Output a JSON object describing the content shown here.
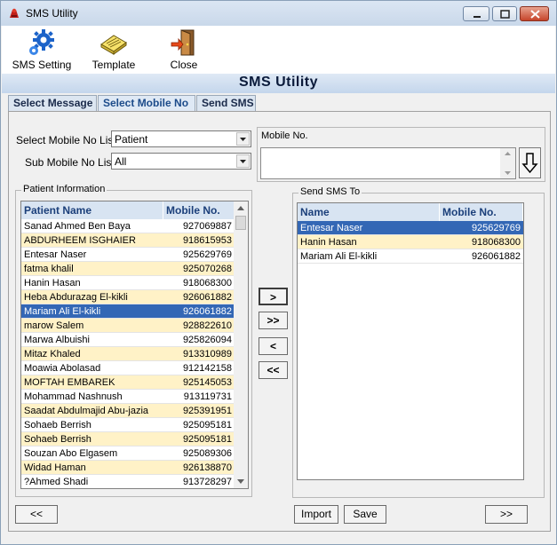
{
  "window": {
    "title": "SMS Utility"
  },
  "toolbar": {
    "sms_setting": "SMS Setting",
    "template": "Template",
    "close": "Close"
  },
  "banner": "SMS Utility",
  "tabs": [
    {
      "label": "Select Message"
    },
    {
      "label": "Select Mobile No"
    },
    {
      "label": "Send SMS"
    }
  ],
  "filters": {
    "mobile_list_label": "Select Mobile No List",
    "mobile_list_value": "Patient",
    "sub_list_label": "Sub Mobile No List",
    "sub_list_value": "All"
  },
  "mobile_no": {
    "label": "Mobile No.",
    "value": ""
  },
  "patients": {
    "title": "Patient Information",
    "col_name": "Patient Name",
    "col_mobile": "Mobile No.",
    "rows": [
      {
        "name": "Sanad Ahmed  Ben Baya",
        "mobile": "927069887"
      },
      {
        "name": "ABDURHEEM ISGHAIER",
        "mobile": "918615953"
      },
      {
        "name": "Entesar Naser",
        "mobile": "925629769"
      },
      {
        "name": "fatma khalil",
        "mobile": "925070268"
      },
      {
        "name": "Hanin Hasan",
        "mobile": "918068300"
      },
      {
        "name": "Heba Abdurazag  El-kikli",
        "mobile": "926061882"
      },
      {
        "name": "Mariam Ali   El-kikli",
        "mobile": "926061882"
      },
      {
        "name": "marow Salem",
        "mobile": "928822610"
      },
      {
        "name": "Marwa Albuishi",
        "mobile": "925826094"
      },
      {
        "name": "Mitaz  Khaled",
        "mobile": "913310989"
      },
      {
        "name": "Moawia Abolasad",
        "mobile": "912142158"
      },
      {
        "name": "MOFTAH EMBAREK",
        "mobile": "925145053"
      },
      {
        "name": "Mohammad Nashnush",
        "mobile": "913119731"
      },
      {
        "name": "Saadat Abdulmajid  Abu-jazia",
        "mobile": "925391951"
      },
      {
        "name": "Sohaeb Berrish",
        "mobile": "925095181"
      },
      {
        "name": "Sohaeb Berrish",
        "mobile": "925095181"
      },
      {
        "name": "Souzan Abo Elgasem",
        "mobile": "925089306"
      },
      {
        "name": "Widad Haman",
        "mobile": "926138870"
      },
      {
        "name": "?Ahmed Shadi",
        "mobile": "913728297"
      }
    ]
  },
  "send_to": {
    "title": "Send SMS To",
    "col_name": "Name",
    "col_mobile": "Mobile No.",
    "rows": [
      {
        "name": "Entesar Naser",
        "mobile": "925629769"
      },
      {
        "name": "Hanin Hasan",
        "mobile": "918068300"
      },
      {
        "name": "Mariam Ali   El-kikli",
        "mobile": "926061882"
      }
    ]
  },
  "move_buttons": {
    "add_one": ">",
    "add_all": ">>",
    "remove_one": "<",
    "remove_all": "<<"
  },
  "bottom": {
    "prev": "<<",
    "import": "Import",
    "save": "Save",
    "next": ">>"
  }
}
